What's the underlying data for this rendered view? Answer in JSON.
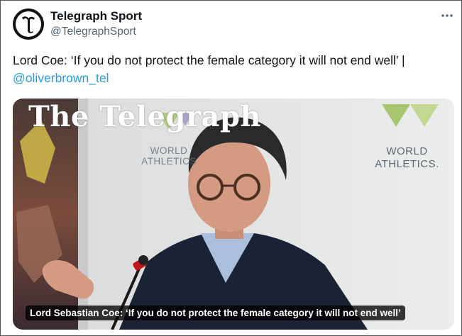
{
  "tweet": {
    "display_name": "Telegraph Sport",
    "handle": "@TelegraphSport",
    "text": "Lord Coe: ‘If you do not protect the female category it will not end well’ |",
    "mention": "@oliverbrown_tel",
    "more_icon": "ellipsis-icon"
  },
  "media": {
    "masthead": "The Telegraph",
    "backdrop_logo_1": "WORLD ATHLETICS",
    "backdrop_logo_2": "WORLD ATHLETICS.",
    "caption": "Lord Sebastian Coe: ‘If you do not protect the female category it will not end well’"
  },
  "colors": {
    "link": "#1d9bf0",
    "text": "#0f1419",
    "secondary": "#536471"
  }
}
